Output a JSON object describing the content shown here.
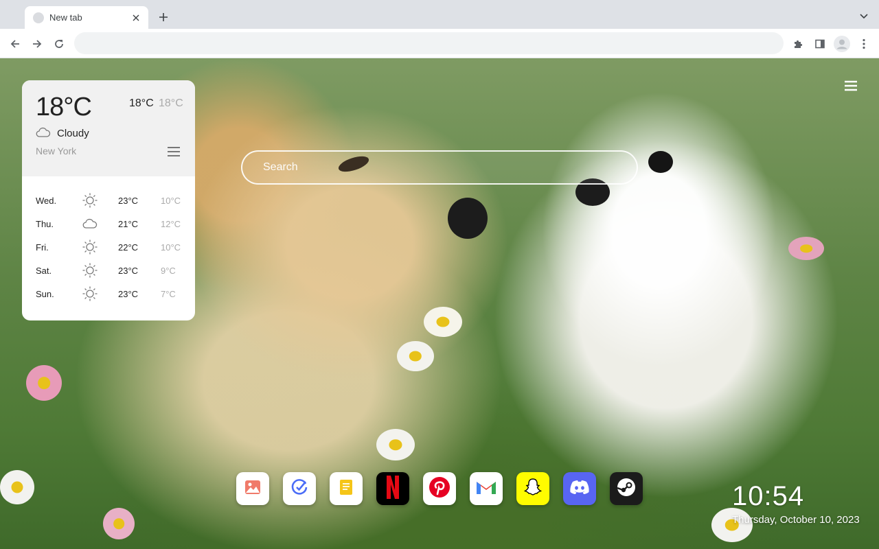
{
  "browser": {
    "tab": {
      "title": "New tab"
    },
    "omnibox": {
      "value": "",
      "placeholder": ""
    }
  },
  "weather": {
    "current_temp": "18°C",
    "high": "18°C",
    "low": "18°C",
    "condition": "Cloudy",
    "condition_icon": "cloud-icon",
    "city": "New York",
    "forecast": [
      {
        "day": "Wed.",
        "icon": "sun-icon",
        "high": "23°C",
        "low": "10°C"
      },
      {
        "day": "Thu.",
        "icon": "cloud-icon",
        "high": "21°C",
        "low": "12°C"
      },
      {
        "day": "Fri.",
        "icon": "sun-icon",
        "high": "22°C",
        "low": "10°C"
      },
      {
        "day": "Sat.",
        "icon": "sun-icon",
        "high": "23°C",
        "low": "9°C"
      },
      {
        "day": "Sun.",
        "icon": "sun-icon",
        "high": "23°C",
        "low": "7°C"
      }
    ]
  },
  "search": {
    "placeholder": "Search"
  },
  "dock": {
    "items": [
      {
        "name": "gallery",
        "icon": "image-icon",
        "bg": "#ffffff"
      },
      {
        "name": "todo",
        "icon": "checkmark-icon",
        "bg": "#ffffff"
      },
      {
        "name": "notes",
        "icon": "notes-icon",
        "bg": "#ffffff"
      },
      {
        "name": "netflix",
        "icon": "netflix-icon",
        "bg": "#000000"
      },
      {
        "name": "pinterest",
        "icon": "pinterest-icon",
        "bg": "#ffffff"
      },
      {
        "name": "gmail",
        "icon": "gmail-icon",
        "bg": "#ffffff"
      },
      {
        "name": "snapchat",
        "icon": "snapchat-icon",
        "bg": "#fffc00"
      },
      {
        "name": "discord",
        "icon": "discord-icon",
        "bg": "#5865f2"
      },
      {
        "name": "steam",
        "icon": "steam-icon",
        "bg": "#1b1b1b"
      }
    ]
  },
  "clock": {
    "time": "10:54",
    "date": "Thursday, October 10, 2023"
  }
}
